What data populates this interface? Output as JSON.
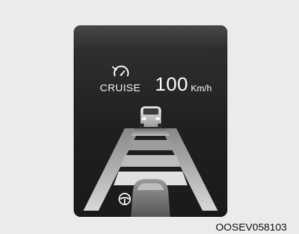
{
  "cluster": {
    "cruise_label": "CRUISE",
    "speed_value": "100",
    "speed_unit": "Km/h",
    "icons": {
      "cruise": "cruise-control-speedometer-icon",
      "steering": "steering-wheel-icon"
    },
    "vehicles": [
      "lead-vehicle",
      "own-vehicle"
    ]
  },
  "caption": "OOSEV058103"
}
